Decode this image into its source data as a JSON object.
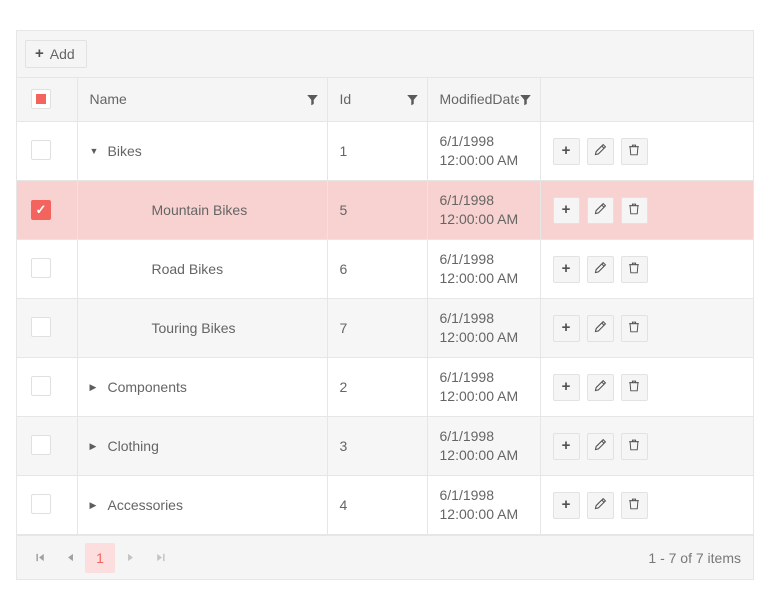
{
  "toolbar": {
    "add_label": "Add",
    "add_icon": "plus-icon"
  },
  "columns": {
    "checkbox": {
      "state": "indeterminate"
    },
    "name": {
      "label": "Name",
      "filter_icon": "filter-funnel-icon"
    },
    "id": {
      "label": "Id",
      "filter_icon": "filter-funnel-icon"
    },
    "modified_date": {
      "label": "ModifiedDate",
      "filter_icon": "filter-funnel-icon"
    },
    "commands": {
      "label": ""
    }
  },
  "commands": {
    "add_icon": "plus-icon",
    "edit_icon": "pencil-icon",
    "delete_icon": "trash-icon"
  },
  "rows": [
    {
      "name": "Bikes",
      "id": "1",
      "date": "6/1/1998",
      "time": "12:00:00 AM",
      "level": 1,
      "expander": "expanded",
      "expander_glyph": "▼",
      "selected": false,
      "checkbox": "unchecked"
    },
    {
      "name": "Mountain Bikes",
      "id": "5",
      "date": "6/1/1998",
      "time": "12:00:00 AM",
      "level": 2,
      "expander": "none",
      "expander_glyph": "",
      "selected": true,
      "checkbox": "checked"
    },
    {
      "name": "Road Bikes",
      "id": "6",
      "date": "6/1/1998",
      "time": "12:00:00 AM",
      "level": 2,
      "expander": "none",
      "expander_glyph": "",
      "selected": false,
      "checkbox": "unchecked"
    },
    {
      "name": "Touring Bikes",
      "id": "7",
      "date": "6/1/1998",
      "time": "12:00:00 AM",
      "level": 2,
      "expander": "none",
      "expander_glyph": "",
      "selected": false,
      "checkbox": "unchecked"
    },
    {
      "name": "Components",
      "id": "2",
      "date": "6/1/1998",
      "time": "12:00:00 AM",
      "level": 1,
      "expander": "collapsed",
      "expander_glyph": "▶",
      "selected": false,
      "checkbox": "unchecked"
    },
    {
      "name": "Clothing",
      "id": "3",
      "date": "6/1/1998",
      "time": "12:00:00 AM",
      "level": 1,
      "expander": "collapsed",
      "expander_glyph": "▶",
      "selected": false,
      "checkbox": "unchecked"
    },
    {
      "name": "Accessories",
      "id": "4",
      "date": "6/1/1998",
      "time": "12:00:00 AM",
      "level": 1,
      "expander": "collapsed",
      "expander_glyph": "▶",
      "selected": false,
      "checkbox": "unchecked"
    }
  ],
  "pager": {
    "first_icon": "go-to-first-page-icon",
    "prev_icon": "previous-page-icon",
    "next_icon": "next-page-icon",
    "last_icon": "go-to-last-page-icon",
    "current_page": "1",
    "info": "1 - 7 of 7 items"
  },
  "colors": {
    "accent": "#f4645f",
    "selected_row": "#f8d2d0",
    "pager_active_bg": "#fbdedd",
    "header_bg": "#f5f5f5",
    "alt_row": "#f6f6f6",
    "border": "#e6e6e6"
  }
}
